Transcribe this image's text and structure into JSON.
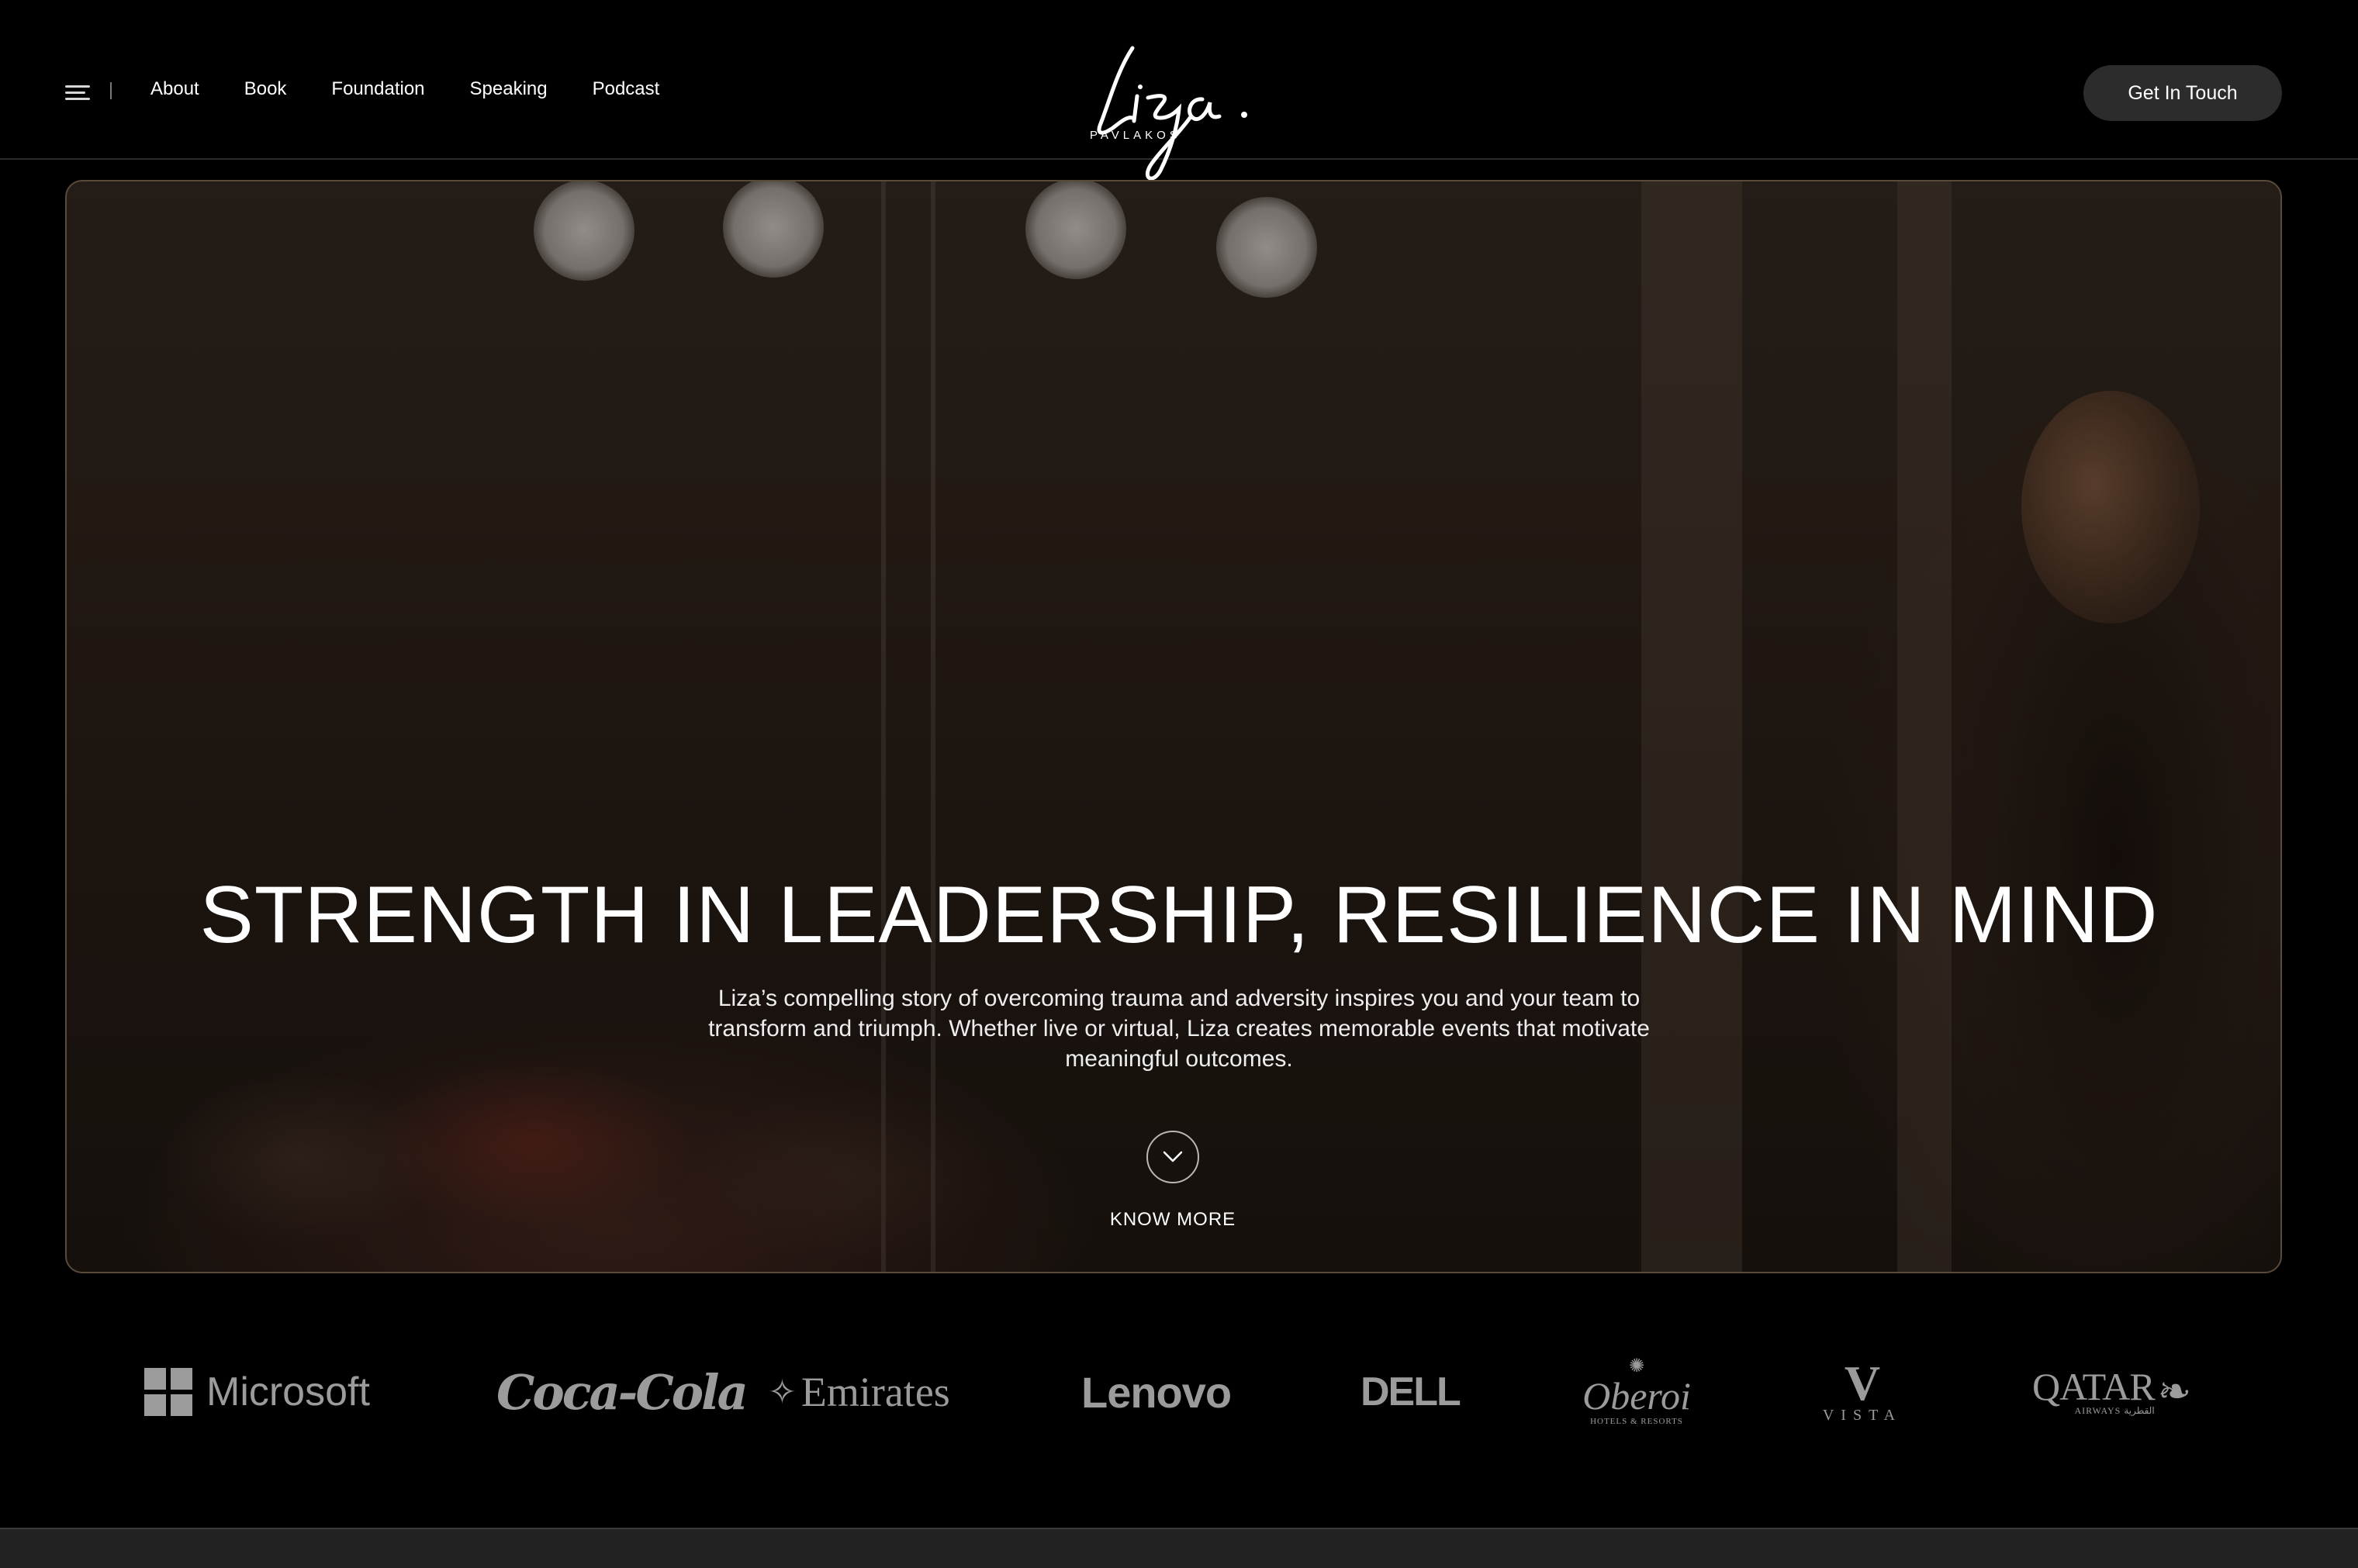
{
  "nav": {
    "menu_icon": "hamburger-icon",
    "items": [
      {
        "label": "About"
      },
      {
        "label": "Book"
      },
      {
        "label": "Foundation"
      },
      {
        "label": "Speaking"
      },
      {
        "label": "Podcast"
      }
    ]
  },
  "logo": {
    "script": "Liza.",
    "name": "PAVLAKOS"
  },
  "header": {
    "cta_label": "Get In Touch"
  },
  "hero": {
    "title": "STRENGTH IN LEADERSHIP, RESILIENCE IN MIND",
    "description": "Liza’s compelling story of overcoming trauma and adversity inspires you and your team to transform and triumph. Whether live or virtual, Liza creates memorable events that motivate meaningful outcomes.",
    "scroll_icon": "chevron-down-icon",
    "know_more_label": "KNOW MORE"
  },
  "clients": {
    "microsoft": "Microsoft",
    "cocacola": "Coca-Cola",
    "emirates": "Emirates",
    "lenovo": "Lenovo",
    "dell": "DELL",
    "oberoi": {
      "name": "Oberoi",
      "sub": "HOTELS & RESORTS"
    },
    "vista": "VISTA",
    "qatar": {
      "name": "QATAR",
      "sub": "AIRWAYS القطرية"
    }
  },
  "colors": {
    "background": "#000000",
    "cta_background": "#2c2c2c",
    "logo_gray": "#9b9b9b",
    "hero_border": "#5a4a3a"
  }
}
